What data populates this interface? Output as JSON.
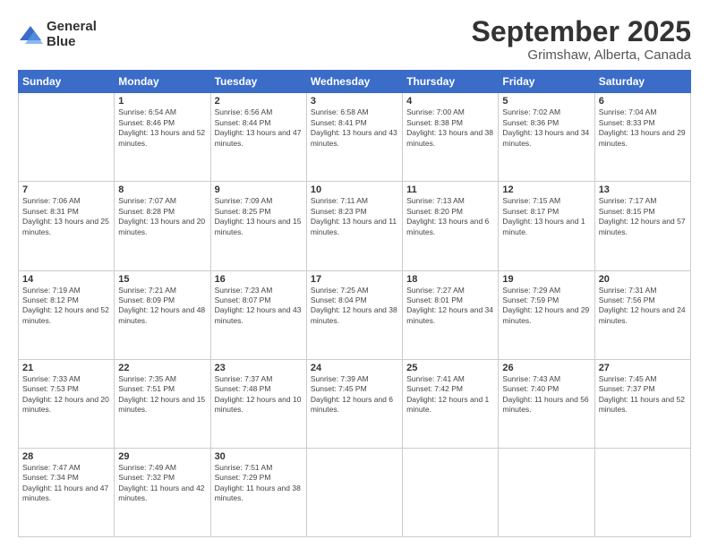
{
  "logo": {
    "line1": "General",
    "line2": "Blue"
  },
  "title": "September 2025",
  "subtitle": "Grimshaw, Alberta, Canada",
  "days_of_week": [
    "Sunday",
    "Monday",
    "Tuesday",
    "Wednesday",
    "Thursday",
    "Friday",
    "Saturday"
  ],
  "weeks": [
    [
      {
        "day": "",
        "info": ""
      },
      {
        "day": "1",
        "info": "Sunrise: 6:54 AM\nSunset: 8:46 PM\nDaylight: 13 hours and 52 minutes."
      },
      {
        "day": "2",
        "info": "Sunrise: 6:56 AM\nSunset: 8:44 PM\nDaylight: 13 hours and 47 minutes."
      },
      {
        "day": "3",
        "info": "Sunrise: 6:58 AM\nSunset: 8:41 PM\nDaylight: 13 hours and 43 minutes."
      },
      {
        "day": "4",
        "info": "Sunrise: 7:00 AM\nSunset: 8:38 PM\nDaylight: 13 hours and 38 minutes."
      },
      {
        "day": "5",
        "info": "Sunrise: 7:02 AM\nSunset: 8:36 PM\nDaylight: 13 hours and 34 minutes."
      },
      {
        "day": "6",
        "info": "Sunrise: 7:04 AM\nSunset: 8:33 PM\nDaylight: 13 hours and 29 minutes."
      }
    ],
    [
      {
        "day": "7",
        "info": "Sunrise: 7:06 AM\nSunset: 8:31 PM\nDaylight: 13 hours and 25 minutes."
      },
      {
        "day": "8",
        "info": "Sunrise: 7:07 AM\nSunset: 8:28 PM\nDaylight: 13 hours and 20 minutes."
      },
      {
        "day": "9",
        "info": "Sunrise: 7:09 AM\nSunset: 8:25 PM\nDaylight: 13 hours and 15 minutes."
      },
      {
        "day": "10",
        "info": "Sunrise: 7:11 AM\nSunset: 8:23 PM\nDaylight: 13 hours and 11 minutes."
      },
      {
        "day": "11",
        "info": "Sunrise: 7:13 AM\nSunset: 8:20 PM\nDaylight: 13 hours and 6 minutes."
      },
      {
        "day": "12",
        "info": "Sunrise: 7:15 AM\nSunset: 8:17 PM\nDaylight: 13 hours and 1 minute."
      },
      {
        "day": "13",
        "info": "Sunrise: 7:17 AM\nSunset: 8:15 PM\nDaylight: 12 hours and 57 minutes."
      }
    ],
    [
      {
        "day": "14",
        "info": "Sunrise: 7:19 AM\nSunset: 8:12 PM\nDaylight: 12 hours and 52 minutes."
      },
      {
        "day": "15",
        "info": "Sunrise: 7:21 AM\nSunset: 8:09 PM\nDaylight: 12 hours and 48 minutes."
      },
      {
        "day": "16",
        "info": "Sunrise: 7:23 AM\nSunset: 8:07 PM\nDaylight: 12 hours and 43 minutes."
      },
      {
        "day": "17",
        "info": "Sunrise: 7:25 AM\nSunset: 8:04 PM\nDaylight: 12 hours and 38 minutes."
      },
      {
        "day": "18",
        "info": "Sunrise: 7:27 AM\nSunset: 8:01 PM\nDaylight: 12 hours and 34 minutes."
      },
      {
        "day": "19",
        "info": "Sunrise: 7:29 AM\nSunset: 7:59 PM\nDaylight: 12 hours and 29 minutes."
      },
      {
        "day": "20",
        "info": "Sunrise: 7:31 AM\nSunset: 7:56 PM\nDaylight: 12 hours and 24 minutes."
      }
    ],
    [
      {
        "day": "21",
        "info": "Sunrise: 7:33 AM\nSunset: 7:53 PM\nDaylight: 12 hours and 20 minutes."
      },
      {
        "day": "22",
        "info": "Sunrise: 7:35 AM\nSunset: 7:51 PM\nDaylight: 12 hours and 15 minutes."
      },
      {
        "day": "23",
        "info": "Sunrise: 7:37 AM\nSunset: 7:48 PM\nDaylight: 12 hours and 10 minutes."
      },
      {
        "day": "24",
        "info": "Sunrise: 7:39 AM\nSunset: 7:45 PM\nDaylight: 12 hours and 6 minutes."
      },
      {
        "day": "25",
        "info": "Sunrise: 7:41 AM\nSunset: 7:42 PM\nDaylight: 12 hours and 1 minute."
      },
      {
        "day": "26",
        "info": "Sunrise: 7:43 AM\nSunset: 7:40 PM\nDaylight: 11 hours and 56 minutes."
      },
      {
        "day": "27",
        "info": "Sunrise: 7:45 AM\nSunset: 7:37 PM\nDaylight: 11 hours and 52 minutes."
      }
    ],
    [
      {
        "day": "28",
        "info": "Sunrise: 7:47 AM\nSunset: 7:34 PM\nDaylight: 11 hours and 47 minutes."
      },
      {
        "day": "29",
        "info": "Sunrise: 7:49 AM\nSunset: 7:32 PM\nDaylight: 11 hours and 42 minutes."
      },
      {
        "day": "30",
        "info": "Sunrise: 7:51 AM\nSunset: 7:29 PM\nDaylight: 11 hours and 38 minutes."
      },
      {
        "day": "",
        "info": ""
      },
      {
        "day": "",
        "info": ""
      },
      {
        "day": "",
        "info": ""
      },
      {
        "day": "",
        "info": ""
      }
    ]
  ]
}
